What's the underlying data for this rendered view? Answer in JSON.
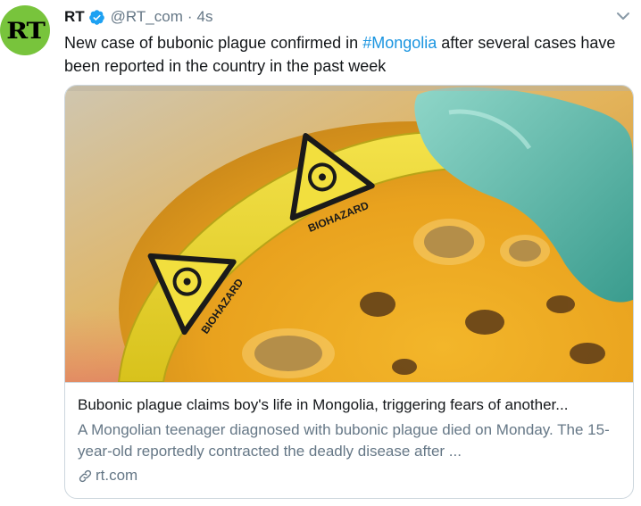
{
  "tweet": {
    "avatar_text": "RT",
    "name": "RT",
    "handle": "@RT_com",
    "separator": "·",
    "time": "4s",
    "text_before": "New case of bubonic plague confirmed in ",
    "hashtag": "#Mongolia",
    "text_after": " after several cases have been reported in the country in the past week"
  },
  "card": {
    "image_label": "BIOHAZARD",
    "title": "Bubonic plague claims boy's life in Mongolia, triggering fears of another...",
    "description": "A Mongolian teenager diagnosed with bubonic plague died on Monday. The 15-year-old reportedly contracted the deadly disease after ...",
    "domain": "rt.com"
  },
  "icons": {
    "verified": "verified-badge-icon",
    "more": "chevron-down-icon",
    "link": "link-icon"
  },
  "colors": {
    "avatar_bg": "#78c43c",
    "verified": "#1da1f2",
    "hashtag": "#1b95e0",
    "secondary_text": "#657786",
    "border": "#ccd6dd"
  }
}
